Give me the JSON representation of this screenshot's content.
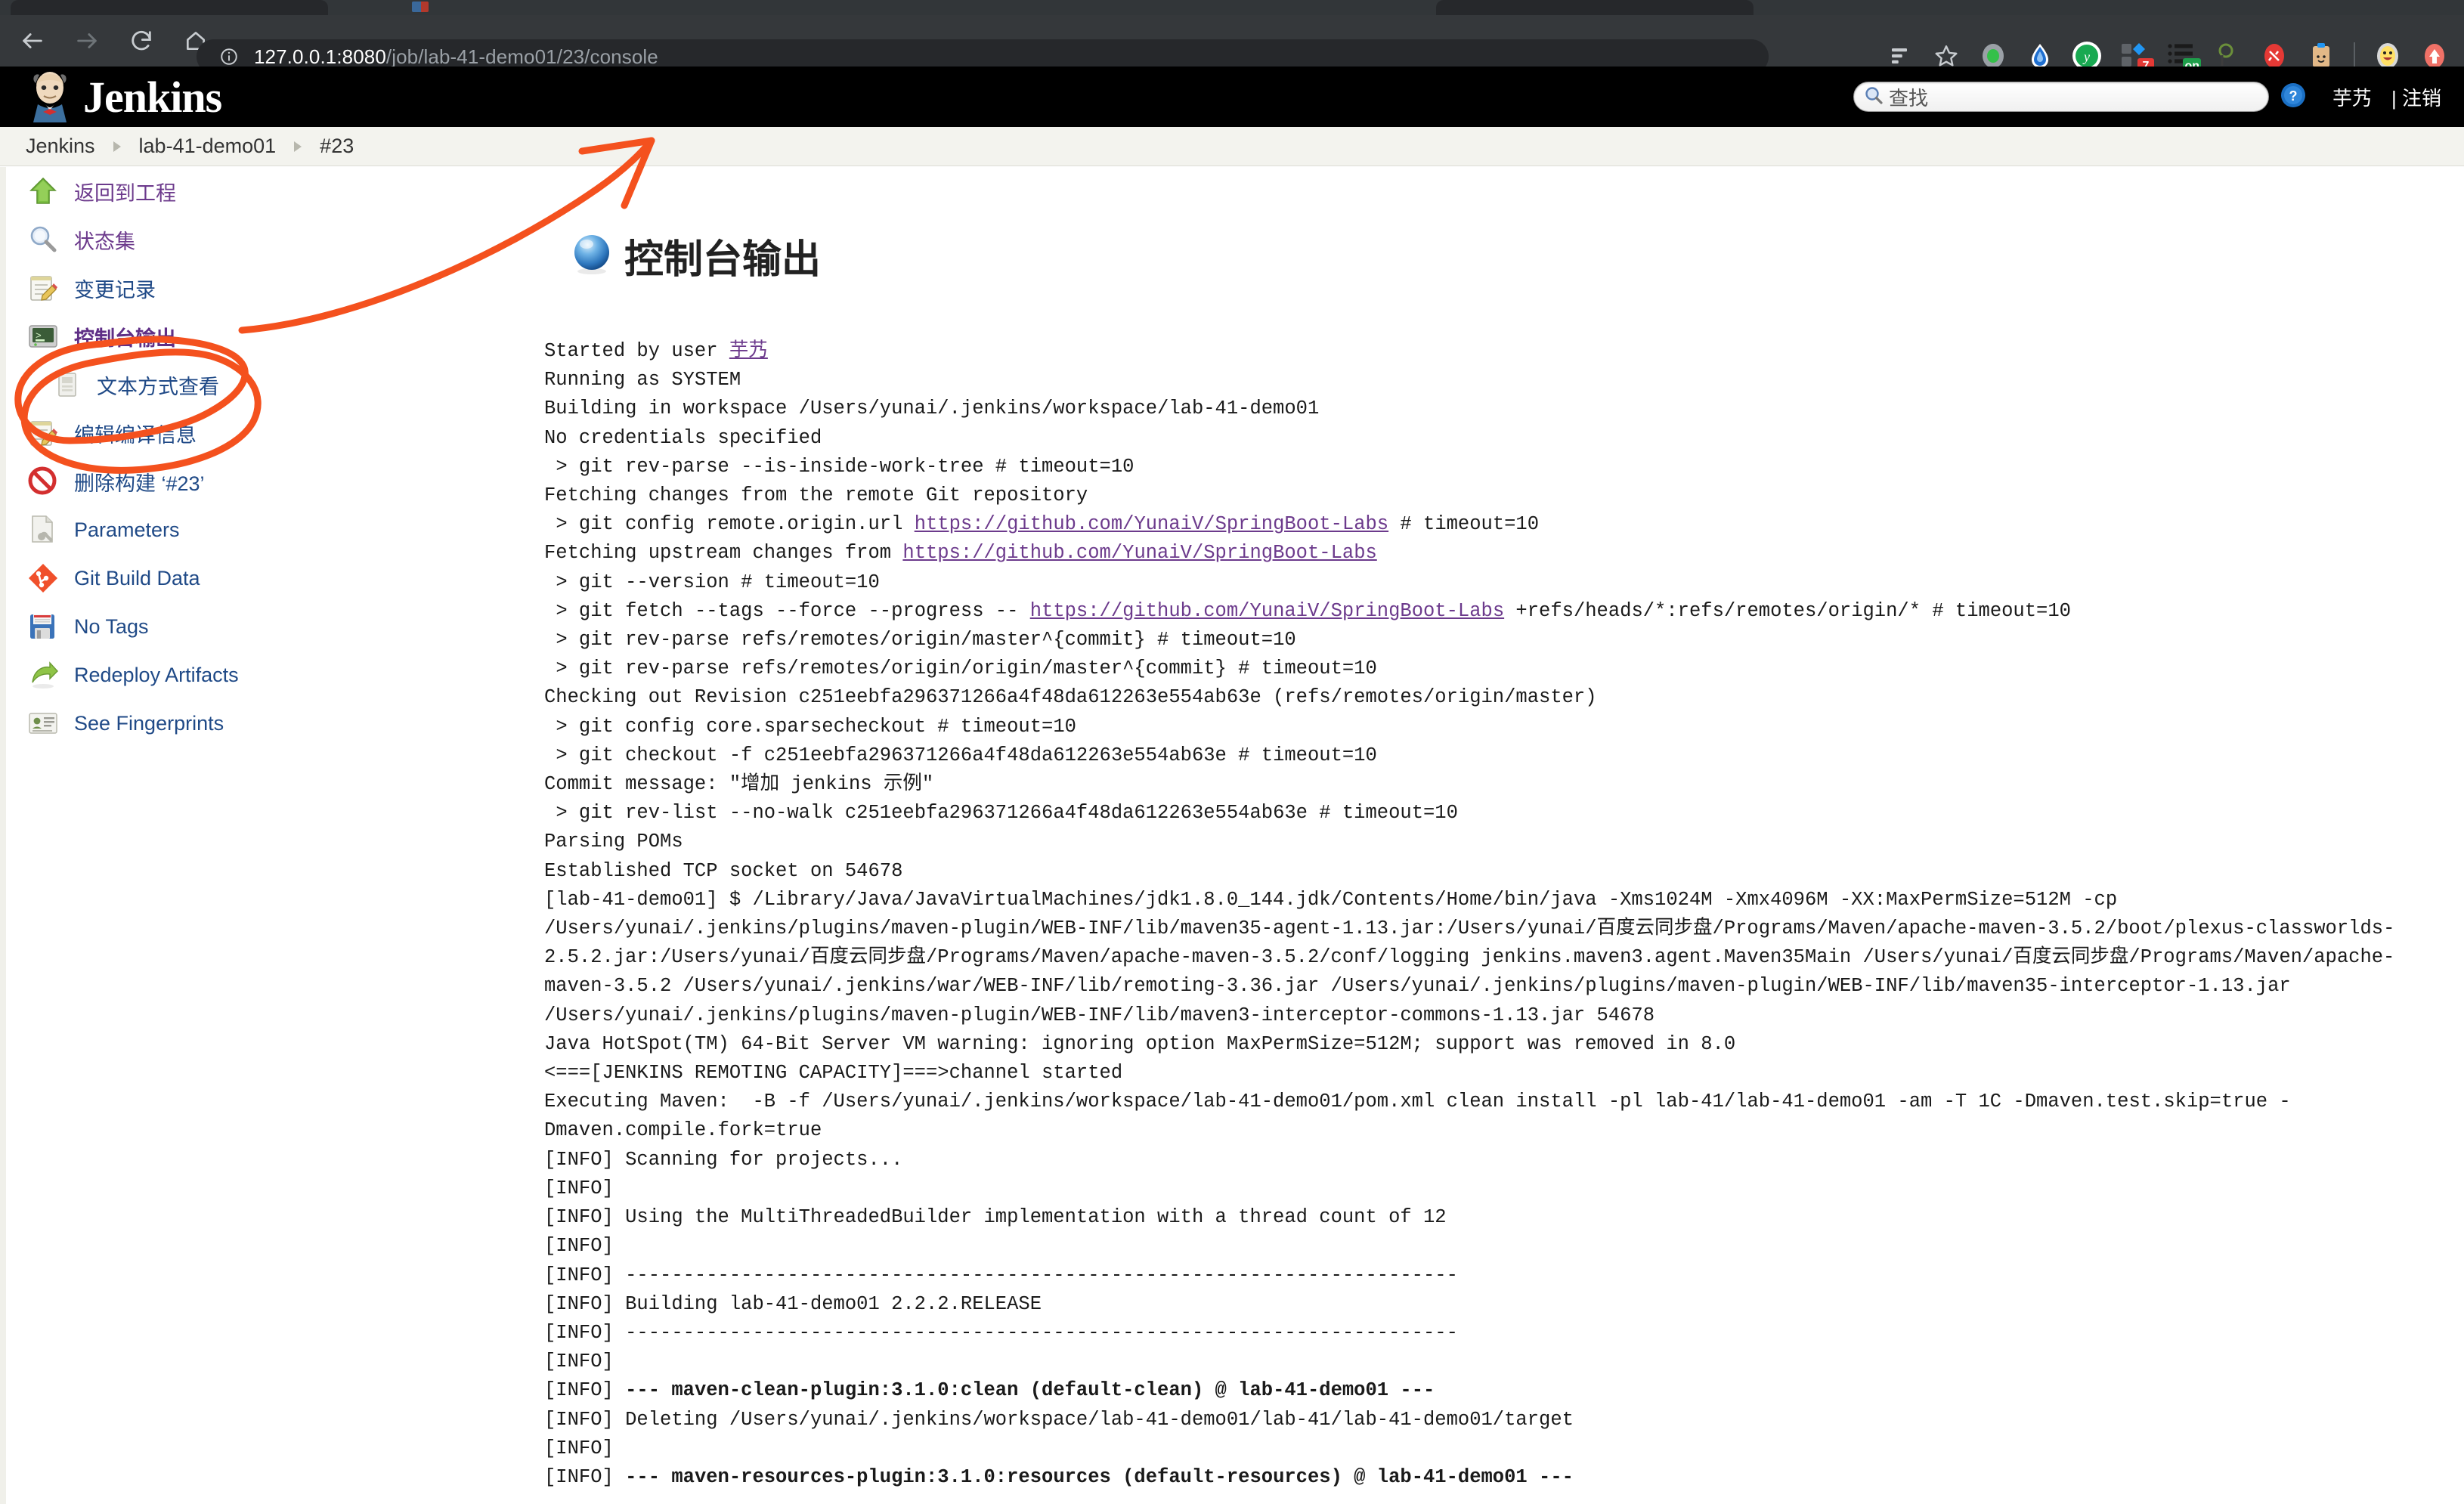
{
  "browser": {
    "back_icon": "back-arrow-icon",
    "forward_icon": "forward-arrow-icon",
    "reload_icon": "reload-icon",
    "home_icon": "home-icon",
    "site_info_icon": "site-info-icon",
    "url_host": "127.0.0.1:8080",
    "url_path": "/job/lab-41-demo01/23/console",
    "url_full": "127.0.0.1:8080/job/lab-41-demo01/23/console",
    "actions": [
      {
        "name": "reading-list-icon",
        "badge": ""
      },
      {
        "name": "bookmark-star-icon",
        "badge": ""
      },
      {
        "name": "extension-green-dot-icon",
        "badge": ""
      },
      {
        "name": "extension-blue-drop-icon",
        "badge": ""
      },
      {
        "name": "extension-youdao-icon",
        "badge": ""
      },
      {
        "name": "extension-blocks-icon",
        "badge": "7"
      },
      {
        "name": "extension-list-icon",
        "badge": "on"
      },
      {
        "name": "extension-magnifier-icon",
        "badge": ""
      },
      {
        "name": "extension-no-plug-icon",
        "badge": ""
      },
      {
        "name": "extension-clipboard-icon",
        "badge": ""
      },
      {
        "name": "profile-avatar-icon",
        "badge": ""
      },
      {
        "name": "extension-upload-icon",
        "badge": ""
      }
    ]
  },
  "header": {
    "brand": "Jenkins",
    "logo_icon": "jenkins-butler-logo-icon",
    "search_icon": "search-magnifier-icon",
    "search_placeholder": "查找",
    "search_value": "",
    "help_icon": "help-question-icon",
    "user_name": "芋艿",
    "logout_label": "| 注销"
  },
  "breadcrumb": {
    "items": [
      "Jenkins",
      "lab-41-demo01",
      "#23"
    ]
  },
  "sidebar": {
    "items": [
      {
        "label": "返回到工程",
        "icon": "green-up-arrow-icon",
        "style": "visited",
        "sub": false
      },
      {
        "label": "状态集",
        "icon": "magnifier-icon",
        "style": "visited",
        "sub": false
      },
      {
        "label": "变更记录",
        "icon": "notepad-pencil-icon",
        "style": "link",
        "sub": false
      },
      {
        "label": "控制台输出",
        "icon": "terminal-icon",
        "style": "bold",
        "sub": false
      },
      {
        "label": "文本方式查看",
        "icon": "document-icon",
        "style": "link",
        "sub": true
      },
      {
        "label": "编辑编译信息",
        "icon": "notepad-pencil-icon",
        "style": "link",
        "sub": false
      },
      {
        "label": "删除构建 ‘#23’",
        "icon": "no-entry-icon",
        "style": "link",
        "sub": false
      },
      {
        "label": "Parameters",
        "icon": "document-wrench-icon",
        "style": "link",
        "sub": false
      },
      {
        "label": "Git Build Data",
        "icon": "git-diamond-icon",
        "style": "link",
        "sub": false
      },
      {
        "label": "No Tags",
        "icon": "floppy-disk-icon",
        "style": "link",
        "sub": false
      },
      {
        "label": "Redeploy Artifacts",
        "icon": "green-redeploy-arrow-icon",
        "style": "link",
        "sub": false
      },
      {
        "label": "See Fingerprints",
        "icon": "fingerprint-card-icon",
        "style": "link",
        "sub": false
      }
    ]
  },
  "main": {
    "title": "控制台输出",
    "title_icon": "blue-ball-icon",
    "console_lines": [
      {
        "t": "Started by user ",
        "link": "芋艿"
      },
      {
        "t": "Running as SYSTEM"
      },
      {
        "t": "Building in workspace /Users/yunai/.jenkins/workspace/lab-41-demo01"
      },
      {
        "t": "No credentials specified"
      },
      {
        "t": " > git rev-parse --is-inside-work-tree # timeout=10"
      },
      {
        "t": "Fetching changes from the remote Git repository"
      },
      {
        "t": " > git config remote.origin.url ",
        "link": "https://github.com/YunaiV/SpringBoot-Labs",
        "t2": " # timeout=10"
      },
      {
        "t": "Fetching upstream changes from ",
        "link": "https://github.com/YunaiV/SpringBoot-Labs"
      },
      {
        "t": " > git --version # timeout=10"
      },
      {
        "t": " > git fetch --tags --force --progress -- ",
        "link": "https://github.com/YunaiV/SpringBoot-Labs",
        "t2": " +refs/heads/*:refs/remotes/origin/* # timeout=10"
      },
      {
        "t": " > git rev-parse refs/remotes/origin/master^{commit} # timeout=10"
      },
      {
        "t": " > git rev-parse refs/remotes/origin/origin/master^{commit} # timeout=10"
      },
      {
        "t": "Checking out Revision c251eebfa296371266a4f48da612263e554ab63e (refs/remotes/origin/master)"
      },
      {
        "t": " > git config core.sparsecheckout # timeout=10"
      },
      {
        "t": " > git checkout -f c251eebfa296371266a4f48da612263e554ab63e # timeout=10"
      },
      {
        "t": "Commit message: \"增加 jenkins 示例\""
      },
      {
        "t": " > git rev-list --no-walk c251eebfa296371266a4f48da612263e554ab63e # timeout=10"
      },
      {
        "t": "Parsing POMs"
      },
      {
        "t": "Established TCP socket on 54678"
      },
      {
        "t": "[lab-41-demo01] $ /Library/Java/JavaVirtualMachines/jdk1.8.0_144.jdk/Contents/Home/bin/java -Xms1024M -Xmx4096M -XX:MaxPermSize=512M -cp /Users/yunai/.jenkins/plugins/maven-plugin/WEB-INF/lib/maven35-agent-1.13.jar:/Users/yunai/百度云同步盘/Programs/Maven/apache-maven-3.5.2/boot/plexus-classworlds-2.5.2.jar:/Users/yunai/百度云同步盘/Programs/Maven/apache-maven-3.5.2/conf/logging jenkins.maven3.agent.Maven35Main /Users/yunai/百度云同步盘/Programs/Maven/apache-maven-3.5.2 /Users/yunai/.jenkins/war/WEB-INF/lib/remoting-3.36.jar /Users/yunai/.jenkins/plugins/maven-plugin/WEB-INF/lib/maven35-interceptor-1.13.jar /Users/yunai/.jenkins/plugins/maven-plugin/WEB-INF/lib/maven3-interceptor-commons-1.13.jar 54678"
      },
      {
        "t": "Java HotSpot(TM) 64-Bit Server VM warning: ignoring option MaxPermSize=512M; support was removed in 8.0"
      },
      {
        "t": "<===[JENKINS REMOTING CAPACITY]===>channel started"
      },
      {
        "t": "Executing Maven:  -B -f /Users/yunai/.jenkins/workspace/lab-41-demo01/pom.xml clean install -pl lab-41/lab-41-demo01 -am -T 1C -Dmaven.test.skip=true -Dmaven.compile.fork=true"
      },
      {
        "t": "[INFO] Scanning for projects..."
      },
      {
        "t": "[INFO]"
      },
      {
        "t": "[INFO] Using the MultiThreadedBuilder implementation with a thread count of 12"
      },
      {
        "t": "[INFO]"
      },
      {
        "t": "[INFO] ------------------------------------------------------------------------"
      },
      {
        "t": "[INFO] Building lab-41-demo01 2.2.2.RELEASE"
      },
      {
        "t": "[INFO] ------------------------------------------------------------------------"
      },
      {
        "t": "[INFO]"
      },
      {
        "t": "[INFO] ",
        "bold": "--- maven-clean-plugin:3.1.0:clean (default-clean) @ lab-41-demo01 ---"
      },
      {
        "t": "[INFO] Deleting /Users/yunai/.jenkins/workspace/lab-41-demo01/lab-41/lab-41-demo01/target"
      },
      {
        "t": "[INFO]"
      },
      {
        "t": "[INFO] ",
        "bold": "--- maven-resources-plugin:3.1.0:resources (default-resources) @ lab-41-demo01 ---"
      }
    ]
  },
  "annotation": {
    "color": "#f4511e",
    "shapes": [
      "highlight-ellipse-console-output",
      "pointer-arrow-to-title"
    ]
  }
}
